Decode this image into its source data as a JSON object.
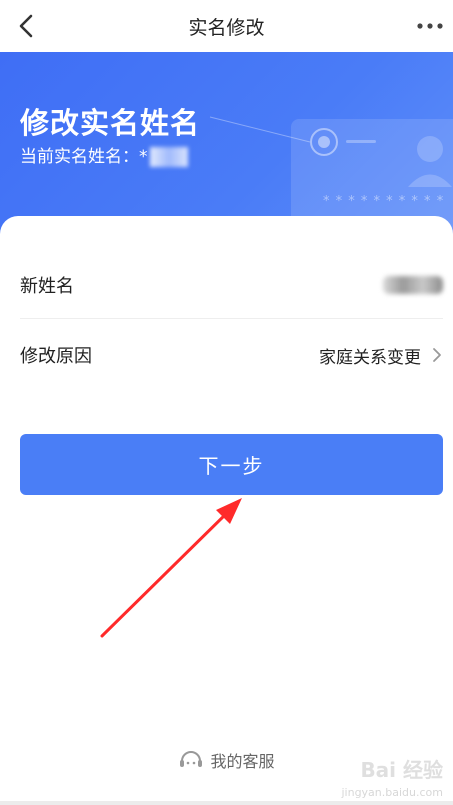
{
  "navbar": {
    "title": "实名修改",
    "back_icon": "chevron-left-icon",
    "more_icon": "more-dots-icon"
  },
  "hero": {
    "title": "修改实名姓名",
    "current_name_label": "当前实名姓名：",
    "current_name_visible": "*"
  },
  "form": {
    "new_name_label": "新姓名",
    "reason_label": "修改原因",
    "reason_value": "家庭关系变更"
  },
  "actions": {
    "next_label": "下一步"
  },
  "footer": {
    "service_label": "我的客服",
    "service_icon": "customer-service-icon",
    "watermark": "Bai 经验",
    "watermark_url": "jingyan.baidu.com"
  },
  "colors": {
    "primary": "#4a7ef6",
    "hero_start": "#3f6ef5",
    "annotation_arrow": "#ff2a2a"
  }
}
